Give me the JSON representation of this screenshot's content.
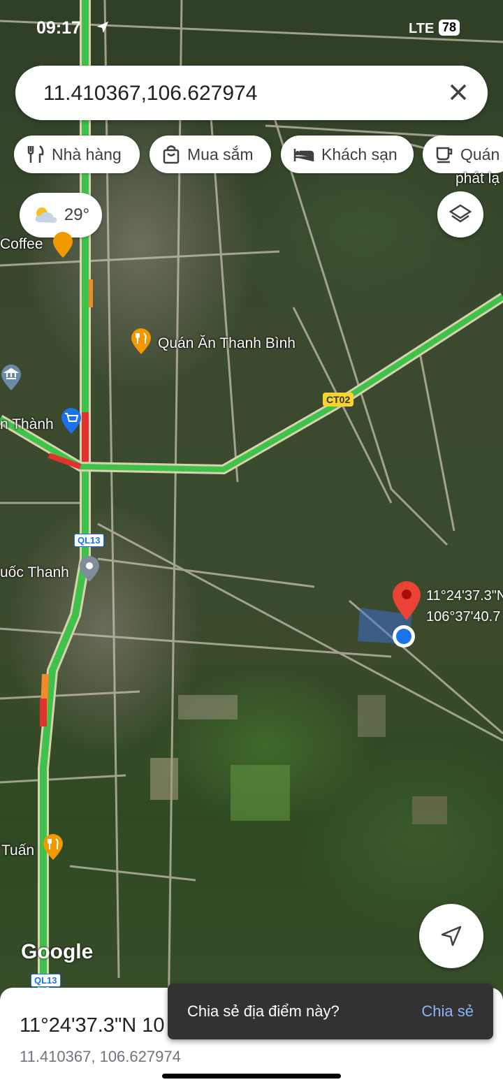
{
  "status_bar": {
    "time": "09:17",
    "network": "LTE",
    "battery": "78"
  },
  "search": {
    "value": "11.410367,106.627974"
  },
  "chips": [
    {
      "label": "Nhà hàng",
      "icon": "fork-knife-icon"
    },
    {
      "label": "Mua sắm",
      "icon": "shopping-bag-icon"
    },
    {
      "label": "Khách sạn",
      "icon": "bed-icon"
    },
    {
      "label": "Quán",
      "icon": "coffee-cup-icon"
    }
  ],
  "weather": {
    "temperature": "29°",
    "icon": "partly-sunny-icon"
  },
  "map_labels": {
    "coffee": "Coffee",
    "quan_an": "Quán Ăn Thanh Bình",
    "thanh": "n Thành",
    "quoc_thanh": "uốc Thanh",
    "tuan": "Tuấn",
    "phat_lap": "phát lạ",
    "pin_lat": "11°24'37.3\"N",
    "pin_lng": "106°37'40.7"
  },
  "road_shields": {
    "ct02": "CT02",
    "ql13_top": "QL13",
    "ql13_bottom": "QL13"
  },
  "google_logo": "Google",
  "place_sheet": {
    "title": "11°24'37.3\"N 10",
    "subtitle": "11.410367, 106.627974"
  },
  "snackbar": {
    "message": "Chia sẻ địa điểm này?",
    "action": "Chia sẻ"
  },
  "colors": {
    "traffic_green": "#3ec24a",
    "traffic_red": "#e0332d",
    "traffic_orange": "#f08a2a",
    "pin_red": "#ea4335",
    "my_location_blue": "#1a73e8"
  }
}
